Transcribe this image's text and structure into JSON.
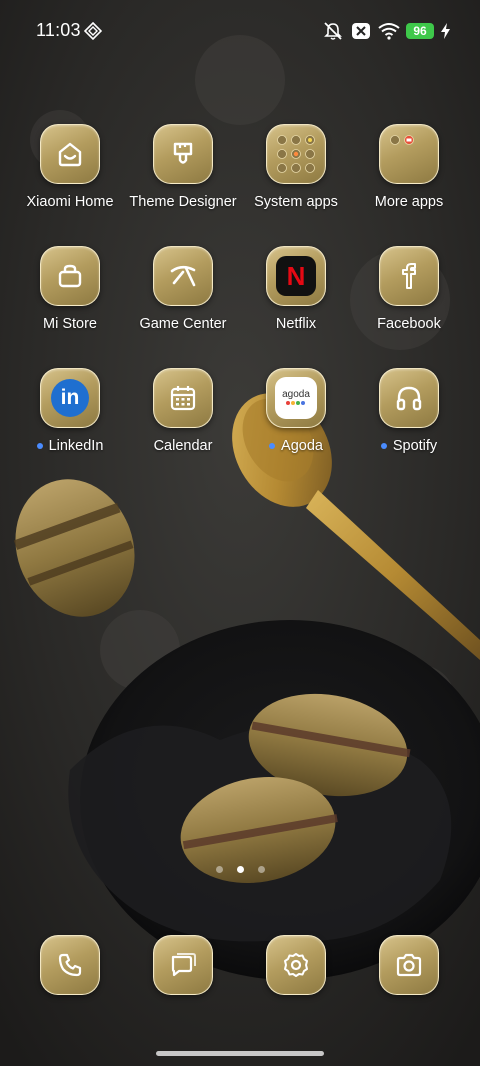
{
  "status_bar": {
    "time": "11:03",
    "battery": "96",
    "icons": [
      "vpn-diamond-icon",
      "silent-bell-icon",
      "x-box-icon",
      "wifi-icon",
      "charging-bolt-icon"
    ]
  },
  "home": {
    "apps": [
      {
        "label": "Xiaomi Home",
        "icon": "house-icon",
        "dot": false
      },
      {
        "label": "Theme Designer",
        "icon": "brush-icon",
        "dot": false
      },
      {
        "label": "System apps",
        "icon": "folder-icon",
        "dot": false
      },
      {
        "label": "More apps",
        "icon": "folder-icon",
        "dot": false
      },
      {
        "label": "Mi Store",
        "icon": "shopping-bag-icon",
        "dot": false
      },
      {
        "label": "Game Center",
        "icon": "game-icon",
        "dot": false
      },
      {
        "label": "Netflix",
        "icon": "netflix-icon",
        "dot": false
      },
      {
        "label": "Facebook",
        "icon": "facebook-icon",
        "dot": false
      },
      {
        "label": "LinkedIn",
        "icon": "linkedin-icon",
        "dot": true
      },
      {
        "label": "Calendar",
        "icon": "calendar-icon",
        "dot": false
      },
      {
        "label": "Agoda",
        "icon": "agoda-icon",
        "dot": true
      },
      {
        "label": "Spotify",
        "icon": "headphones-icon",
        "dot": true
      }
    ],
    "netflix_letter": "N",
    "linkedin_text": "in",
    "agoda_text": "agoda",
    "new_app_dot_color": "#4a8cff",
    "page_count": 3,
    "active_page": 2
  },
  "dock": {
    "apps": [
      "phone-icon",
      "messages-icon",
      "settings-icon",
      "camera-icon"
    ]
  },
  "colors": {
    "icon_gold": "#b39c5e",
    "battery_green": "#3ec84a"
  }
}
